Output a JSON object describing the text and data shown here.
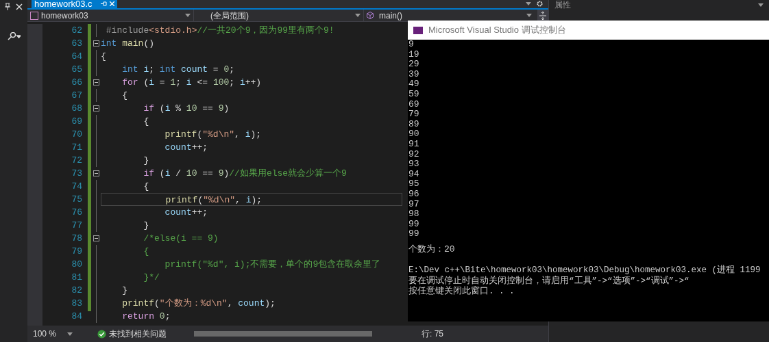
{
  "editor": {
    "tab": {
      "label": "homework03.c",
      "selected": true
    },
    "nav": {
      "project": "homework03",
      "scope": "(全局范围)",
      "member": "main()"
    },
    "lines": [
      {
        "number": "62",
        "fold": false,
        "current": false,
        "tokens": [
          {
            "kind": "directive",
            "text": " #include"
          },
          {
            "kind": "string",
            "text": "<stdio.h>"
          },
          {
            "kind": "comment",
            "text": "//一共20个9，因为99里有两个9!"
          }
        ]
      },
      {
        "number": "63",
        "fold": true,
        "current": false,
        "tokens": [
          {
            "kind": "keyword",
            "text": "int"
          },
          {
            "kind": "func",
            "text": " main"
          },
          {
            "kind": "plain",
            "text": "()"
          }
        ]
      },
      {
        "number": "64",
        "fold": false,
        "current": false,
        "tokens": [
          {
            "kind": "plain",
            "text": "{"
          }
        ]
      },
      {
        "number": "65",
        "fold": false,
        "current": false,
        "tokens": [
          {
            "kind": "keyword",
            "text": "    int"
          },
          {
            "kind": "var",
            "text": " i"
          },
          {
            "kind": "plain",
            "text": "; "
          },
          {
            "kind": "keyword",
            "text": "int"
          },
          {
            "kind": "var",
            "text": " count"
          },
          {
            "kind": "plain",
            "text": " = "
          },
          {
            "kind": "number",
            "text": "0"
          },
          {
            "kind": "plain",
            "text": ";"
          }
        ]
      },
      {
        "number": "66",
        "fold": true,
        "current": false,
        "tokens": [
          {
            "kind": "control",
            "text": "    for"
          },
          {
            "kind": "plain",
            "text": " ("
          },
          {
            "kind": "var",
            "text": "i"
          },
          {
            "kind": "plain",
            "text": " = "
          },
          {
            "kind": "number",
            "text": "1"
          },
          {
            "kind": "plain",
            "text": "; "
          },
          {
            "kind": "var",
            "text": "i"
          },
          {
            "kind": "plain",
            "text": " <= "
          },
          {
            "kind": "number",
            "text": "100"
          },
          {
            "kind": "plain",
            "text": "; "
          },
          {
            "kind": "var",
            "text": "i"
          },
          {
            "kind": "plain",
            "text": "++)"
          }
        ]
      },
      {
        "number": "67",
        "fold": false,
        "current": false,
        "tokens": [
          {
            "kind": "plain",
            "text": "    {"
          }
        ]
      },
      {
        "number": "68",
        "fold": true,
        "current": false,
        "tokens": [
          {
            "kind": "control",
            "text": "        if"
          },
          {
            "kind": "plain",
            "text": " ("
          },
          {
            "kind": "var",
            "text": "i"
          },
          {
            "kind": "plain",
            "text": " % "
          },
          {
            "kind": "number",
            "text": "10"
          },
          {
            "kind": "plain",
            "text": " == "
          },
          {
            "kind": "number",
            "text": "9"
          },
          {
            "kind": "plain",
            "text": ")"
          }
        ]
      },
      {
        "number": "69",
        "fold": false,
        "current": false,
        "tokens": [
          {
            "kind": "plain",
            "text": "        {"
          }
        ]
      },
      {
        "number": "70",
        "fold": false,
        "current": false,
        "tokens": [
          {
            "kind": "func",
            "text": "            printf"
          },
          {
            "kind": "plain",
            "text": "("
          },
          {
            "kind": "string",
            "text": "\"%d\\n\""
          },
          {
            "kind": "plain",
            "text": ", "
          },
          {
            "kind": "var",
            "text": "i"
          },
          {
            "kind": "plain",
            "text": ");"
          }
        ]
      },
      {
        "number": "71",
        "fold": false,
        "current": false,
        "tokens": [
          {
            "kind": "var",
            "text": "            count"
          },
          {
            "kind": "plain",
            "text": "++;"
          }
        ]
      },
      {
        "number": "72",
        "fold": false,
        "current": false,
        "tokens": [
          {
            "kind": "plain",
            "text": "        }"
          }
        ]
      },
      {
        "number": "73",
        "fold": true,
        "current": false,
        "tokens": [
          {
            "kind": "control",
            "text": "        if"
          },
          {
            "kind": "plain",
            "text": " ("
          },
          {
            "kind": "var",
            "text": "i"
          },
          {
            "kind": "plain",
            "text": " / "
          },
          {
            "kind": "number",
            "text": "10"
          },
          {
            "kind": "plain",
            "text": " == "
          },
          {
            "kind": "number",
            "text": "9"
          },
          {
            "kind": "plain",
            "text": ")"
          },
          {
            "kind": "comment",
            "text": "//如果用else就会少算一个9"
          }
        ]
      },
      {
        "number": "74",
        "fold": false,
        "current": false,
        "tokens": [
          {
            "kind": "plain",
            "text": "        {"
          }
        ]
      },
      {
        "number": "75",
        "fold": false,
        "current": true,
        "tokens": [
          {
            "kind": "func",
            "text": "            printf"
          },
          {
            "kind": "plain",
            "text": "("
          },
          {
            "kind": "string",
            "text": "\"%d\\n\""
          },
          {
            "kind": "plain",
            "text": ", "
          },
          {
            "kind": "var",
            "text": "i"
          },
          {
            "kind": "plain",
            "text": ");"
          }
        ]
      },
      {
        "number": "76",
        "fold": false,
        "current": false,
        "tokens": [
          {
            "kind": "var",
            "text": "            count"
          },
          {
            "kind": "plain",
            "text": "++;"
          }
        ]
      },
      {
        "number": "77",
        "fold": false,
        "current": false,
        "tokens": [
          {
            "kind": "plain",
            "text": "        }"
          }
        ]
      },
      {
        "number": "78",
        "fold": true,
        "current": false,
        "tokens": [
          {
            "kind": "comment",
            "text": "        /*else(i == 9)"
          }
        ]
      },
      {
        "number": "79",
        "fold": false,
        "current": false,
        "tokens": [
          {
            "kind": "comment",
            "text": "        {"
          }
        ]
      },
      {
        "number": "80",
        "fold": false,
        "current": false,
        "tokens": [
          {
            "kind": "comment",
            "text": "            printf(\"%d\", i);不需要，单个的9包含在取余里了"
          }
        ]
      },
      {
        "number": "81",
        "fold": false,
        "current": false,
        "tokens": [
          {
            "kind": "comment",
            "text": "        }*/"
          }
        ]
      },
      {
        "number": "82",
        "fold": false,
        "current": false,
        "tokens": [
          {
            "kind": "plain",
            "text": "    }"
          }
        ]
      },
      {
        "number": "83",
        "fold": false,
        "current": false,
        "tokens": [
          {
            "kind": "func",
            "text": "    printf"
          },
          {
            "kind": "plain",
            "text": "("
          },
          {
            "kind": "string",
            "text": "\"个数为：%d\\n\""
          },
          {
            "kind": "plain",
            "text": ", "
          },
          {
            "kind": "var",
            "text": "count"
          },
          {
            "kind": "plain",
            "text": ");"
          }
        ]
      },
      {
        "number": "84",
        "fold": false,
        "current": false,
        "tokens": [
          {
            "kind": "control",
            "text": "    return"
          },
          {
            "kind": "number",
            "text": " 0"
          },
          {
            "kind": "plain",
            "text": ";"
          }
        ]
      }
    ],
    "status": {
      "zoom": "100 %",
      "issues": "未找到相关问题",
      "position": "行: 75"
    }
  },
  "properties_panel": {
    "title": "属性"
  },
  "console": {
    "title": "Microsoft Visual Studio 调试控制台",
    "output": [
      "9",
      "19",
      "29",
      "39",
      "49",
      "59",
      "69",
      "79",
      "89",
      "90",
      "91",
      "92",
      "93",
      "94",
      "95",
      "96",
      "97",
      "98",
      "99",
      "99"
    ],
    "summary": "个数为：20",
    "messages": [
      "E:\\Dev c++\\Bite\\homework03\\homework03\\Debug\\homework03.exe (进程 1199",
      "要在调试停止时自动关闭控制台，请启用“工具”->“选项”->“调试”->“",
      "按任意键关闭此窗口. . ."
    ]
  }
}
